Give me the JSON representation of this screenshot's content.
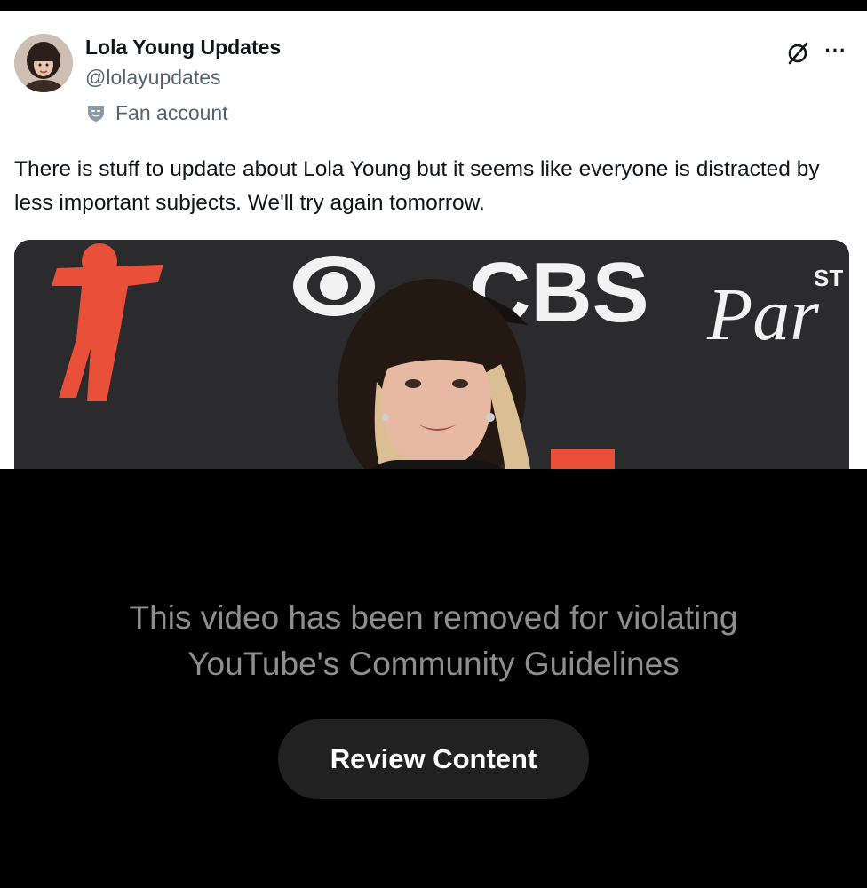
{
  "tweet": {
    "display_name": "Lola Young Updates",
    "handle": "@lolayupdates",
    "account_label": "Fan account",
    "text": "There is stuff to update about Lola Young but it seems like everyone is distracted by less important subjects. We'll try again tomorrow.",
    "grok_icon": "slashed-circle-icon",
    "more_icon": "more-icon",
    "more_glyph": "···",
    "media": {
      "backdrop_text_1": "CBS",
      "backdrop_text_2": "ST",
      "backdrop_text_3": "Par"
    }
  },
  "overlay": {
    "message_line_1": "This video has been removed for violating",
    "message_line_2": "YouTube's Community Guidelines",
    "button_label": "Review Content"
  },
  "colors": {
    "overlay_bg": "#000000",
    "button_bg": "#212121",
    "message_text": "#8e8e8e",
    "backdrop_red": "#e8503a"
  }
}
